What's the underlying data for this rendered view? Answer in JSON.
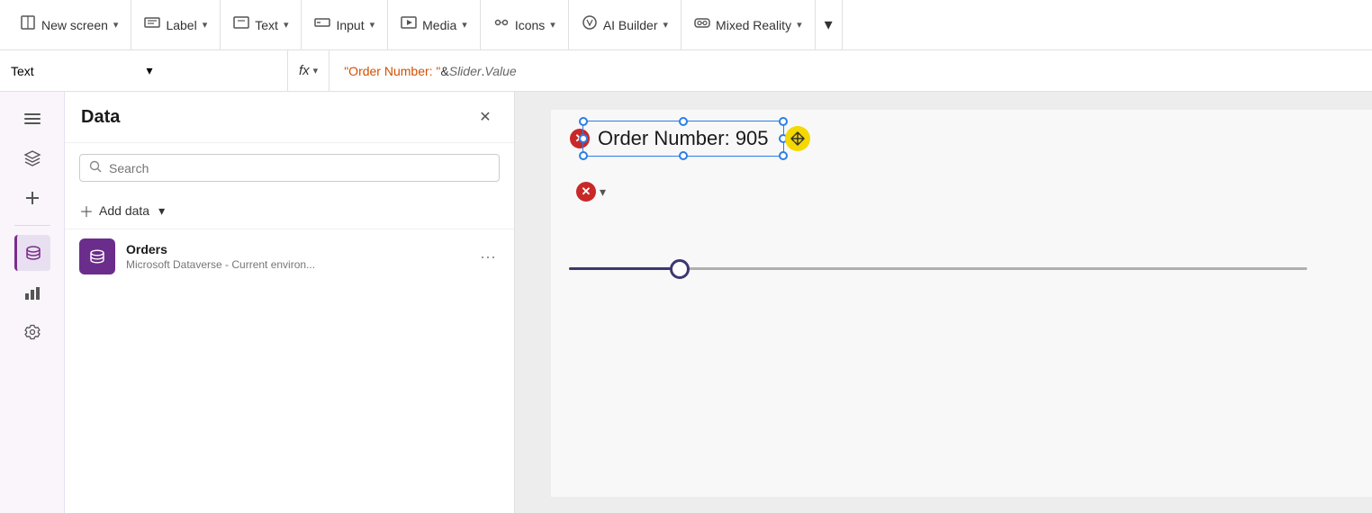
{
  "toolbar": {
    "new_screen_label": "New screen",
    "label_label": "Label",
    "text_label": "Text",
    "input_label": "Input",
    "media_label": "Media",
    "icons_label": "Icons",
    "ai_builder_label": "AI Builder",
    "mixed_reality_label": "Mixed Reality"
  },
  "formula_bar": {
    "property_label": "Text",
    "formula_text": "\"Order Number: \" & Slider.Value"
  },
  "data_panel": {
    "title": "Data",
    "search_placeholder": "Search",
    "add_data_label": "Add data",
    "source": {
      "name": "Orders",
      "subtitle": "Microsoft Dataverse - Current environ..."
    }
  },
  "canvas": {
    "text_element_label": "Order Number: 905",
    "slider_value": 905
  },
  "sidebar": {
    "icons": [
      "☰",
      "⬡",
      "+",
      "⬜",
      "📊",
      "⚙"
    ]
  }
}
